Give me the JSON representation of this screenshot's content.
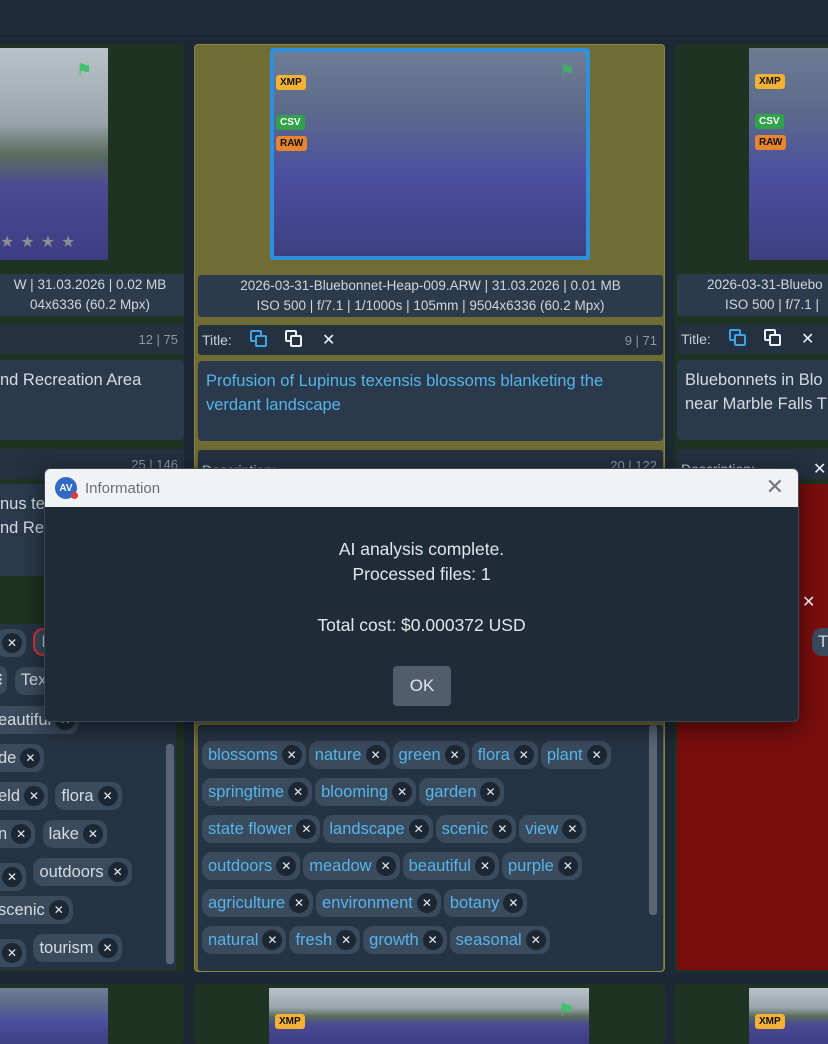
{
  "badges": {
    "xmp": "XMP",
    "csv": "CSV",
    "raw": "RAW"
  },
  "cards": {
    "left": {
      "info_line1": "W | 31.03.2026 | 0.02 MB",
      "info_line2": "04x6336 (60.2 Mpx)",
      "title_counter": "12 | 75",
      "title_text_line1": "nd Recreation Area",
      "desc_counter": "25 | 146",
      "desc_text_line1": "nus te",
      "desc_text_line2": "nd Rec",
      "tags": [
        [
          "Lu"
        ],
        [
          "Tex"
        ],
        [
          "eautiful"
        ],
        [
          "de"
        ],
        [
          "eld",
          "flora"
        ],
        [
          "n",
          "lake"
        ],
        [
          "",
          "outdoors"
        ],
        [
          "scenic"
        ],
        [
          "",
          "tourism"
        ]
      ]
    },
    "center": {
      "info_line1": "2026-03-31-Bluebonnet-Heap-009.ARW | 31.03.2026 | 0.01 MB",
      "info_line2": "ISO 500 | f/7.1 | 1/1000s | 105mm | 9504x6336 (60.2 Mpx)",
      "title_label": "Title:",
      "title_counter": "9 | 71",
      "title_text": "Profusion of Lupinus texensis blossoms blanketing the verdant landscape",
      "desc_label": "Description:",
      "desc_counter": "20 | 122",
      "tags_rows": [
        [
          "blossoms",
          "nature",
          "green",
          "flora",
          "plant"
        ],
        [
          "springtime",
          "blooming",
          "garden"
        ],
        [
          "state flower",
          "landscape",
          "scenic",
          "view"
        ],
        [
          "outdoors",
          "meadow",
          "beautiful",
          "purple"
        ],
        [
          "agriculture",
          "environment",
          "botany"
        ],
        [
          "natural",
          "fresh",
          "growth",
          "seasonal"
        ]
      ]
    },
    "right": {
      "info_line1": "2026-03-31-Bluebo",
      "info_line2": "ISO 500 | f/7.1 |",
      "title_label": "Title:",
      "title_text_line1": "Bluebonnets in Blo",
      "title_text_line2": "near Marble Falls T",
      "desc_label": "Description:",
      "tag_partial": "T"
    }
  },
  "modal": {
    "title": "Information",
    "logo_text": "AV",
    "line1": "AI analysis complete.",
    "line2": "Processed files: 1",
    "line3": "Total cost: $0.000372 USD",
    "ok_label": "OK"
  },
  "icons": {
    "close": "×",
    "flag": "flag-icon",
    "copy": "copy-icon"
  }
}
